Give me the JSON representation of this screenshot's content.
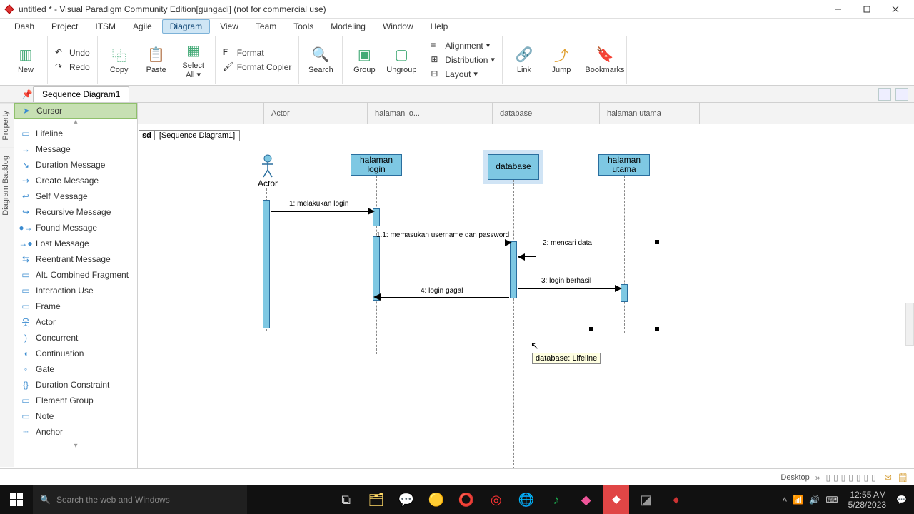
{
  "window": {
    "title": "untitled * - Visual Paradigm Community Edition[gungadi] (not for commercial use)"
  },
  "menu": {
    "items": [
      "Dash",
      "Project",
      "ITSM",
      "Agile",
      "Diagram",
      "View",
      "Team",
      "Tools",
      "Modeling",
      "Window",
      "Help"
    ],
    "active_index": 4
  },
  "ribbon": {
    "new": "New",
    "undo": "Undo",
    "redo": "Redo",
    "copy": "Copy",
    "paste": "Paste",
    "select_all": "Select\nAll ▾",
    "format": "Format",
    "format_copier": "Format Copier",
    "search": "Search",
    "group": "Group",
    "ungroup": "Ungroup",
    "alignment": "Alignment",
    "distribution": "Distribution",
    "layout": "Layout",
    "link": "Link",
    "jump": "Jump",
    "bookmarks": "Bookmarks"
  },
  "doc_tab": "Sequence Diagram1",
  "vtabs": [
    "Property",
    "Diagram Backlog"
  ],
  "palette": {
    "items": [
      "Cursor",
      "Lifeline",
      "Message",
      "Duration Message",
      "Create Message",
      "Self Message",
      "Recursive Message",
      "Found Message",
      "Lost Message",
      "Reentrant Message",
      "Alt. Combined Fragment",
      "Interaction Use",
      "Frame",
      "Actor",
      "Concurrent",
      "Continuation",
      "Gate",
      "Duration Constraint",
      "Element Group",
      "Note",
      "Anchor"
    ],
    "selected_index": 0
  },
  "lanes": [
    "Actor",
    "halaman lo...",
    "database",
    "halaman utama"
  ],
  "sd_frame": {
    "tag": "sd",
    "name": "[Sequence Diagram1]"
  },
  "lifelines": {
    "actor_label": "Actor",
    "l1": "halaman login",
    "l2": "database",
    "l3": "halaman utama"
  },
  "messages": {
    "m1": "1: melakukan login",
    "m1_1": "1.1: memasukan username dan password",
    "m2": "2: mencari data",
    "m3": "3: login berhasil",
    "m4": "4: login gagal"
  },
  "tooltip": "database: Lifeline",
  "status2": {
    "desktop": "Desktop"
  },
  "taskbar": {
    "search_placeholder": "Search the web and Windows",
    "time": "12:55 AM",
    "date": "5/28/2023"
  }
}
